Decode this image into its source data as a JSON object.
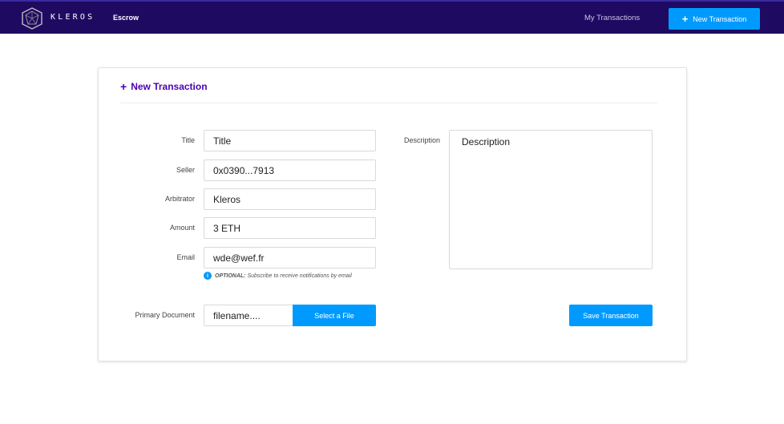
{
  "navbar": {
    "logo_text": "KLEROS",
    "escrow_label": "Escrow",
    "my_transactions_label": "My Transactions",
    "new_transaction_label": "New Transaction"
  },
  "form": {
    "title": "New Transaction",
    "fields": {
      "title": {
        "label": "Title",
        "value": "Title"
      },
      "seller": {
        "label": "Seller",
        "value": "0x0390...7913"
      },
      "arbitrator": {
        "label": "Arbitrator",
        "value": "Kleros"
      },
      "amount": {
        "label": "Amount",
        "value": "3 ETH"
      },
      "email": {
        "label": "Email",
        "value": "wde@wef.fr"
      },
      "description": {
        "label": "Description",
        "value": "Description"
      },
      "primary_document": {
        "label": "Primary Document",
        "value": "filename...."
      }
    },
    "email_hint_strong": "OPTIONAL:",
    "email_hint_text": " Subscribe to receive notifications by email",
    "hint_icon_glyph": "i",
    "select_file_label": "Select a File",
    "save_label": "Save Transaction"
  },
  "colors": {
    "navbar_bg": "#1f0a62",
    "accent_blue": "#009aff",
    "title_purple": "#4d00b4"
  }
}
